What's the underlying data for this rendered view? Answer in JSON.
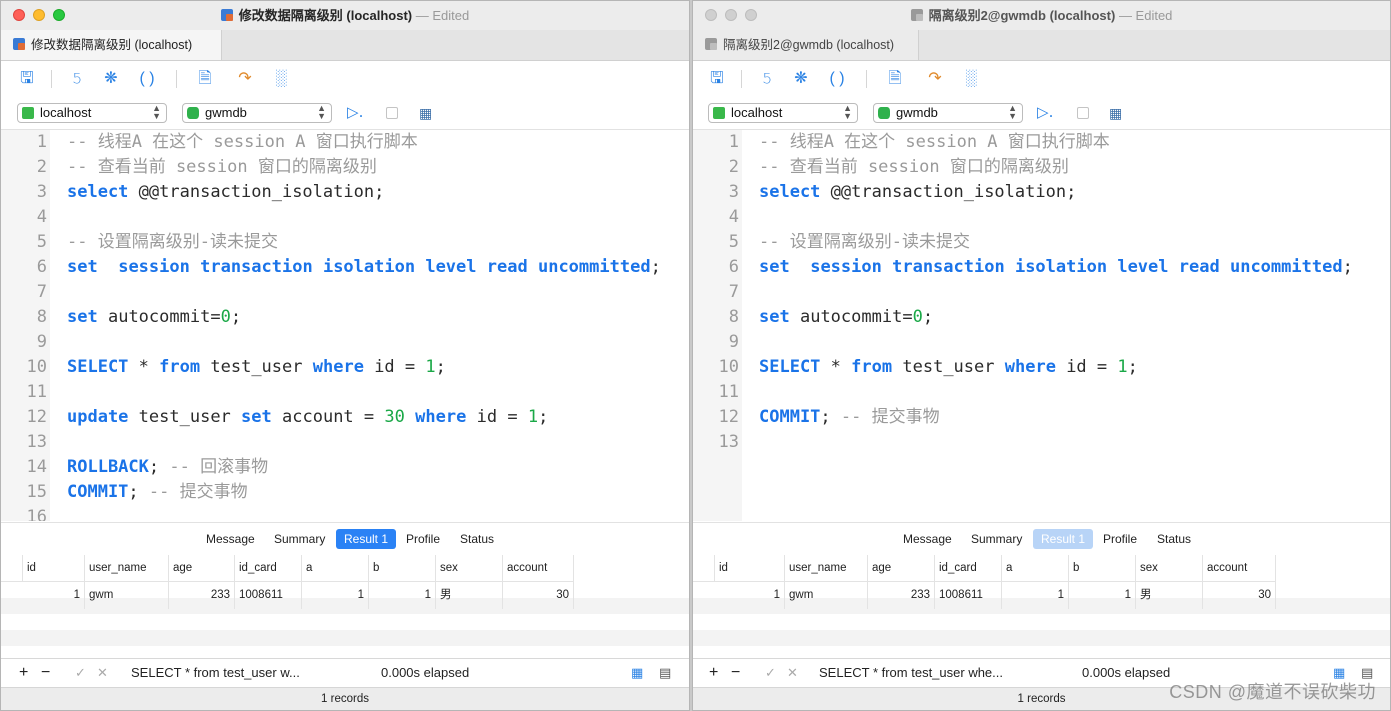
{
  "windows": [
    {
      "title": "修改数据隔离级别 (localhost)",
      "edited": "— Edited",
      "tab": "修改数据隔离级别 (localhost)",
      "connection": "localhost",
      "database": "gwmdb",
      "lines": [
        "-- 线程A 在这个 session A 窗口执行脚本",
        "-- 查看当前 session 窗口的隔离级别",
        "select @@transaction_isolation;",
        "",
        "-- 设置隔离级别-读未提交",
        "set  session transaction isolation level read uncommitted;",
        "",
        "set autocommit=0;",
        "",
        "SELECT * from test_user where id = 1;",
        "",
        "update test_user set account = 30 where id = 1;",
        "",
        "ROLLBACK; -- 回滚事物",
        "COMMIT; -- 提交事物",
        ""
      ],
      "line_numbers": [
        "1",
        "2",
        "3",
        "4",
        "5",
        "6",
        "7",
        "8",
        "9",
        "10",
        "11",
        "12",
        "13",
        "14",
        "15",
        "16"
      ],
      "result_tabs": [
        "Message",
        "Summary",
        "Result 1",
        "Profile",
        "Status"
      ],
      "columns": [
        "id",
        "user_name",
        "age",
        "id_card",
        "a",
        "b",
        "sex",
        "account"
      ],
      "rows": [
        [
          "1",
          "gwm",
          "233",
          "1008611",
          "1",
          "1",
          "男",
          "30"
        ]
      ],
      "status_sql": "SELECT * from test_user w...",
      "elapsed": "0.000s elapsed",
      "records": "1 records"
    },
    {
      "title": "隔离级别2@gwmdb (localhost)",
      "edited": "— Edited",
      "tab": "隔离级别2@gwmdb (localhost)",
      "connection": "localhost",
      "database": "gwmdb",
      "lines": [
        "-- 线程A 在这个 session A 窗口执行脚本",
        "-- 查看当前 session 窗口的隔离级别",
        "select @@transaction_isolation;",
        "",
        "-- 设置隔离级别-读未提交",
        "set  session transaction isolation level read uncommitted;",
        "",
        "set autocommit=0;",
        "",
        "SELECT * from test_user where id = 1;",
        "",
        "COMMIT; -- 提交事物",
        ""
      ],
      "line_numbers": [
        "1",
        "2",
        "3",
        "4",
        "5",
        "6",
        "7",
        "8",
        "9",
        "10",
        "11",
        "12",
        "13"
      ],
      "result_tabs": [
        "Message",
        "Summary",
        "Result 1",
        "Profile",
        "Status"
      ],
      "columns": [
        "id",
        "user_name",
        "age",
        "id_card",
        "a",
        "b",
        "sex",
        "account"
      ],
      "rows": [
        [
          "1",
          "gwm",
          "233",
          "1008611",
          "1",
          "1",
          "男",
          "30"
        ]
      ],
      "status_sql": "SELECT * from test_user whe...",
      "elapsed": "0.000s elapsed",
      "records": "1 records"
    }
  ],
  "watermark": "CSDN @魔道不误砍柴功",
  "colors": {
    "keyword": "#1a73e8",
    "number": "#1aa847",
    "comment": "#9a9a9a",
    "active_tab": "#2a82f5"
  },
  "icons": [
    "save-icon",
    "format-icon",
    "beautify-icon",
    "parentheses-icon",
    "explain-icon",
    "export-icon",
    "chart-icon",
    "run-icon",
    "stop-icon",
    "tree-icon",
    "add-icon",
    "remove-icon",
    "check-icon",
    "cross-icon",
    "grid-view-icon",
    "form-view-icon"
  ]
}
